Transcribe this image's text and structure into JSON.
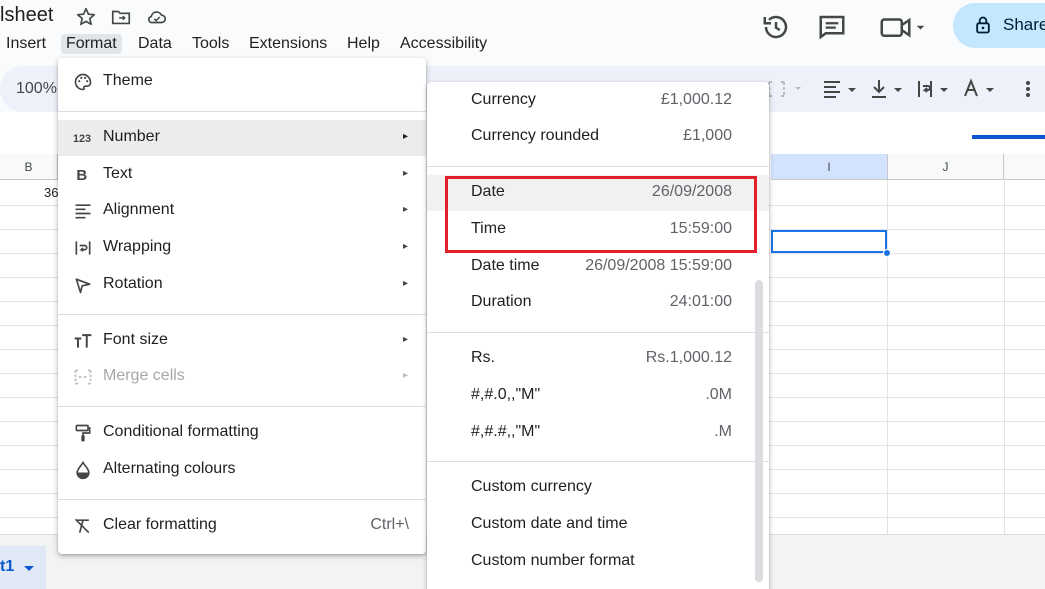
{
  "window": {
    "doc_title": "lsheet",
    "menubar": [
      "Insert",
      "Format",
      "Data",
      "Tools",
      "Extensions",
      "Help",
      "Accessibility"
    ],
    "share_label": "Share"
  },
  "icons": {
    "star": "star-icon",
    "move": "move-to-folder-icon",
    "cloud": "cloud-saved-icon",
    "history": "history-icon",
    "comment": "comment-icon",
    "meet": "video-call-icon",
    "lock": "lock-icon"
  },
  "toolbar": {
    "zoom": "100%"
  },
  "sheet": {
    "columns": [
      "B",
      "I",
      "J"
    ],
    "cell_b2": "36",
    "tab_label": "t1"
  },
  "format_menu": {
    "items": [
      {
        "label": "Theme",
        "icon": "palette-icon"
      },
      {
        "label": "Number",
        "icon": "number-123-icon",
        "arrow": "▸"
      },
      {
        "label": "Text",
        "icon": "bold-b-icon",
        "arrow": "▸"
      },
      {
        "label": "Alignment",
        "icon": "align-left-icon",
        "arrow": "▸"
      },
      {
        "label": "Wrapping",
        "icon": "text-wrap-icon",
        "arrow": "▸"
      },
      {
        "label": "Rotation",
        "icon": "text-rotation-icon",
        "arrow": "▸"
      },
      {
        "label": "Font size",
        "icon": "font-size-icon",
        "arrow": "▸"
      },
      {
        "label": "Merge cells",
        "icon": "merge-cells-icon",
        "arrow": "▸"
      },
      {
        "label": "Conditional formatting",
        "icon": "paint-roller-icon"
      },
      {
        "label": "Alternating colours",
        "icon": "droplet-icon"
      },
      {
        "label": "Clear formatting",
        "icon": "clear-format-icon",
        "shortcut": "Ctrl+\\"
      }
    ]
  },
  "number_submenu": {
    "items": [
      {
        "label": "Currency",
        "value": "£1,000.12"
      },
      {
        "label": "Currency rounded",
        "value": "£1,000"
      },
      {
        "label": "Date",
        "value": "26/09/2008"
      },
      {
        "label": "Time",
        "value": "15:59:00"
      },
      {
        "label": "Date time",
        "value": "26/09/2008 15:59:00"
      },
      {
        "label": "Duration",
        "value": "24:01:00"
      },
      {
        "label": "Rs.",
        "value": "Rs.1,000.12"
      },
      {
        "label": "#,#.0,,\"M\"",
        "value": ".0M"
      },
      {
        "label": "#,#.#,,\"M\"",
        "value": ".M"
      },
      {
        "label": "Custom currency",
        "value": ""
      },
      {
        "label": "Custom date and time",
        "value": ""
      },
      {
        "label": "Custom number format",
        "value": ""
      }
    ]
  },
  "colors": {
    "highlight_box": "#e0202a",
    "share_bg": "#c2e7ff",
    "selection": "#1a73e8"
  }
}
